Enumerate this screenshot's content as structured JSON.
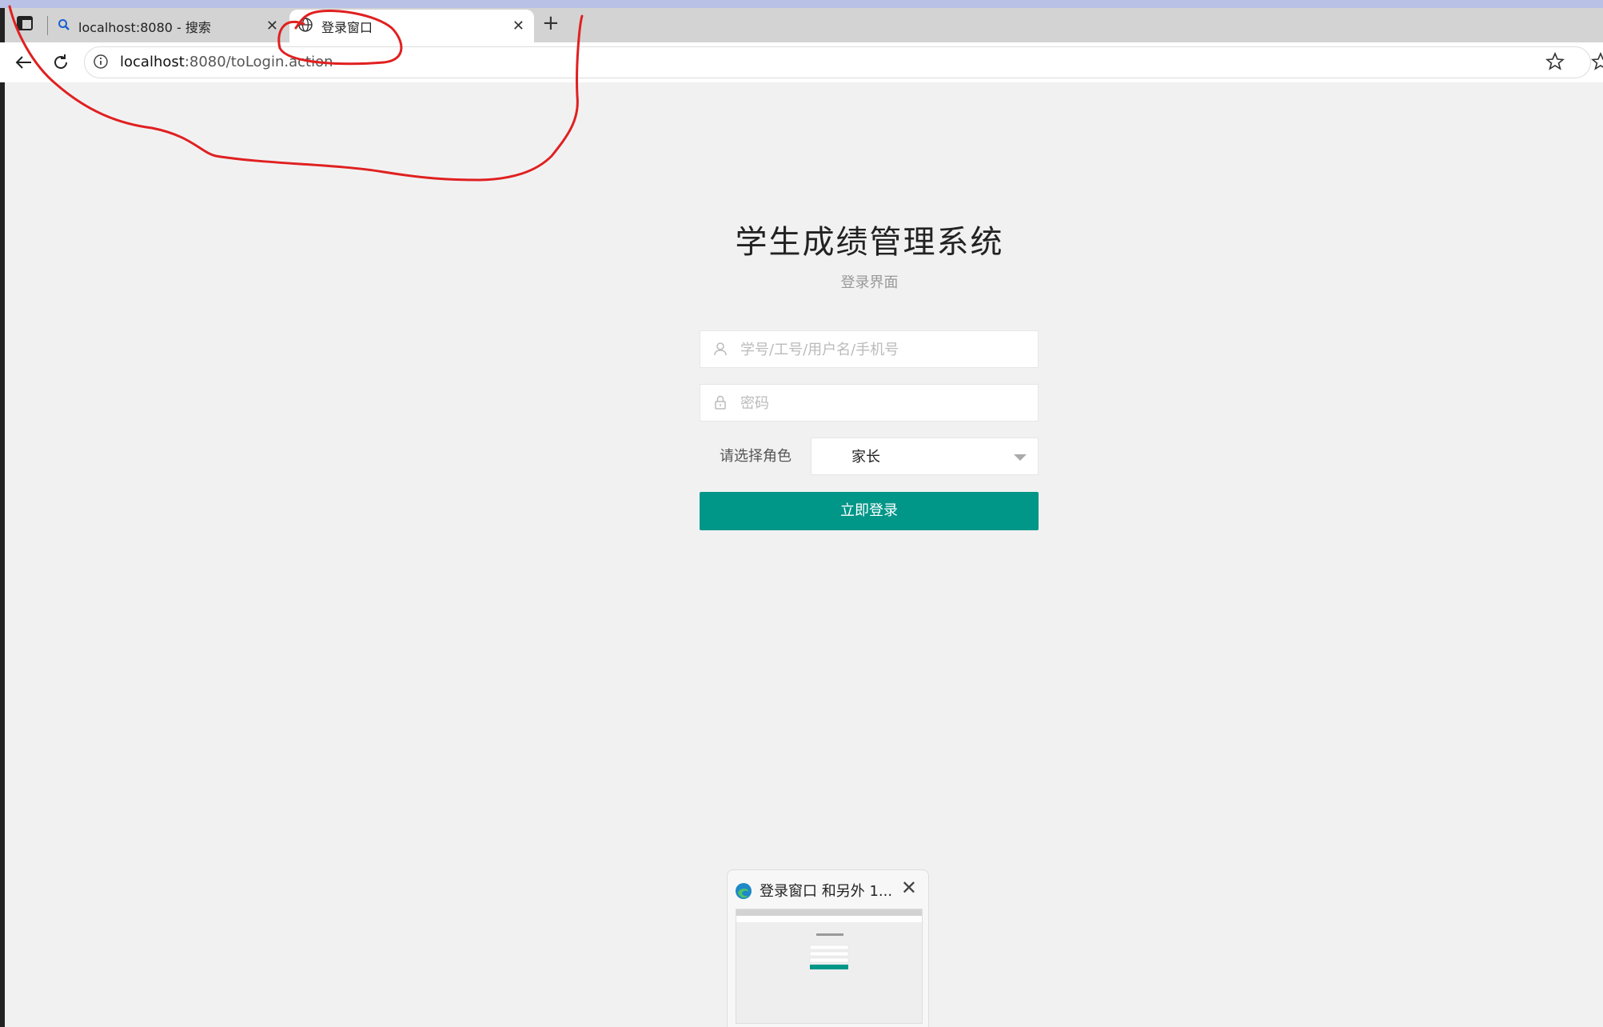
{
  "browser": {
    "tabs": [
      {
        "label": "localhost:8080 - 搜索",
        "active": false
      },
      {
        "label": "登录窗口",
        "active": true
      }
    ],
    "url_host": "localhost",
    "url_rest": ":8080/toLogin.action"
  },
  "login": {
    "title": "学生成绩管理系统",
    "subtitle": "登录界面",
    "username_placeholder": "学号/工号/用户名/手机号",
    "password_placeholder": "密码",
    "role_label": "请选择角色",
    "role_value": "家长",
    "submit_label": "立即登录"
  },
  "taskbar_preview": {
    "title": "登录窗口 和另外 1..."
  },
  "colors": {
    "accent": "#009688",
    "annotation": "#e02020"
  }
}
